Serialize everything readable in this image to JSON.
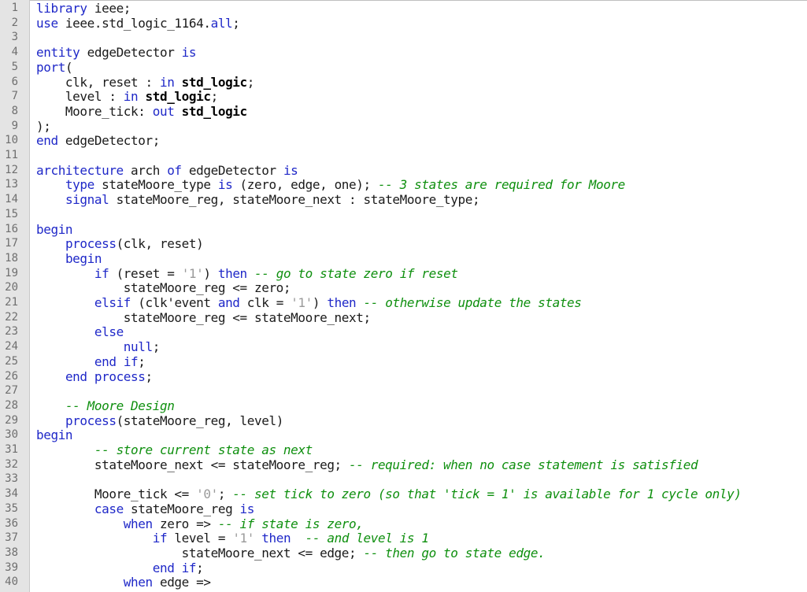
{
  "colors": {
    "keyword": "#1f28c8",
    "comment": "#0e8f0e",
    "string": "#9a9a9a",
    "plain": "#1a1a1a",
    "type_bold": "#000000",
    "gutter_background": "#e4e4e4",
    "line_number": "#6f6f6f"
  },
  "lines": [
    {
      "n": "1",
      "tokens": [
        {
          "t": "library",
          "k": "kw"
        },
        {
          "t": " ieee;",
          "k": "plain"
        }
      ]
    },
    {
      "n": "2",
      "tokens": [
        {
          "t": "use",
          "k": "kw"
        },
        {
          "t": " ieee.std_logic_1164.",
          "k": "plain"
        },
        {
          "t": "all",
          "k": "kw"
        },
        {
          "t": ";",
          "k": "plain"
        }
      ]
    },
    {
      "n": "3",
      "tokens": []
    },
    {
      "n": "4",
      "tokens": [
        {
          "t": "entity",
          "k": "kw"
        },
        {
          "t": " edgeDetector ",
          "k": "plain"
        },
        {
          "t": "is",
          "k": "kw"
        }
      ]
    },
    {
      "n": "5",
      "tokens": [
        {
          "t": "port",
          "k": "kw"
        },
        {
          "t": "(",
          "k": "plain"
        }
      ]
    },
    {
      "n": "6",
      "tokens": [
        {
          "t": "    clk, reset : ",
          "k": "plain"
        },
        {
          "t": "in",
          "k": "kw"
        },
        {
          "t": " ",
          "k": "plain"
        },
        {
          "t": "std_logic",
          "k": "type"
        },
        {
          "t": ";",
          "k": "plain"
        }
      ]
    },
    {
      "n": "7",
      "tokens": [
        {
          "t": "    level : ",
          "k": "plain"
        },
        {
          "t": "in",
          "k": "kw"
        },
        {
          "t": " ",
          "k": "plain"
        },
        {
          "t": "std_logic",
          "k": "type"
        },
        {
          "t": ";",
          "k": "plain"
        }
      ]
    },
    {
      "n": "8",
      "tokens": [
        {
          "t": "    Moore_tick: ",
          "k": "plain"
        },
        {
          "t": "out",
          "k": "kw"
        },
        {
          "t": " ",
          "k": "plain"
        },
        {
          "t": "std_logic",
          "k": "type"
        }
      ]
    },
    {
      "n": "9",
      "tokens": [
        {
          "t": ");",
          "k": "plain"
        }
      ]
    },
    {
      "n": "10",
      "tokens": [
        {
          "t": "end",
          "k": "kw"
        },
        {
          "t": " edgeDetector;",
          "k": "plain"
        }
      ]
    },
    {
      "n": "11",
      "tokens": []
    },
    {
      "n": "12",
      "tokens": [
        {
          "t": "architecture",
          "k": "kw"
        },
        {
          "t": " arch ",
          "k": "plain"
        },
        {
          "t": "of",
          "k": "kw"
        },
        {
          "t": " edgeDetector ",
          "k": "plain"
        },
        {
          "t": "is",
          "k": "kw"
        }
      ]
    },
    {
      "n": "13",
      "tokens": [
        {
          "t": "    ",
          "k": "plain"
        },
        {
          "t": "type",
          "k": "kw"
        },
        {
          "t": " stateMoore_type ",
          "k": "plain"
        },
        {
          "t": "is",
          "k": "kw"
        },
        {
          "t": " (zero, edge, one); ",
          "k": "plain"
        },
        {
          "t": "-- 3 states are required for Moore",
          "k": "comment"
        }
      ]
    },
    {
      "n": "14",
      "tokens": [
        {
          "t": "    ",
          "k": "plain"
        },
        {
          "t": "signal",
          "k": "kw"
        },
        {
          "t": " stateMoore_reg, stateMoore_next : stateMoore_type;",
          "k": "plain"
        }
      ]
    },
    {
      "n": "15",
      "tokens": []
    },
    {
      "n": "16",
      "tokens": [
        {
          "t": "begin",
          "k": "kw"
        }
      ]
    },
    {
      "n": "17",
      "tokens": [
        {
          "t": "    ",
          "k": "plain"
        },
        {
          "t": "process",
          "k": "kw"
        },
        {
          "t": "(clk, reset)",
          "k": "plain"
        }
      ]
    },
    {
      "n": "18",
      "tokens": [
        {
          "t": "    ",
          "k": "plain"
        },
        {
          "t": "begin",
          "k": "kw"
        }
      ]
    },
    {
      "n": "19",
      "tokens": [
        {
          "t": "        ",
          "k": "plain"
        },
        {
          "t": "if",
          "k": "kw"
        },
        {
          "t": " (reset = ",
          "k": "plain"
        },
        {
          "t": "'1'",
          "k": "str"
        },
        {
          "t": ") ",
          "k": "plain"
        },
        {
          "t": "then",
          "k": "kw"
        },
        {
          "t": " ",
          "k": "plain"
        },
        {
          "t": "-- go to state zero if reset",
          "k": "comment"
        }
      ]
    },
    {
      "n": "20",
      "tokens": [
        {
          "t": "            stateMoore_reg <= zero;",
          "k": "plain"
        }
      ]
    },
    {
      "n": "21",
      "tokens": [
        {
          "t": "        ",
          "k": "plain"
        },
        {
          "t": "elsif",
          "k": "kw"
        },
        {
          "t": " (clk'event ",
          "k": "plain"
        },
        {
          "t": "and",
          "k": "kw"
        },
        {
          "t": " clk = ",
          "k": "plain"
        },
        {
          "t": "'1'",
          "k": "str"
        },
        {
          "t": ") ",
          "k": "plain"
        },
        {
          "t": "then",
          "k": "kw"
        },
        {
          "t": " ",
          "k": "plain"
        },
        {
          "t": "-- otherwise update the states",
          "k": "comment"
        }
      ]
    },
    {
      "n": "22",
      "tokens": [
        {
          "t": "            stateMoore_reg <= stateMoore_next;",
          "k": "plain"
        }
      ]
    },
    {
      "n": "23",
      "tokens": [
        {
          "t": "        ",
          "k": "plain"
        },
        {
          "t": "else",
          "k": "kw"
        }
      ]
    },
    {
      "n": "24",
      "tokens": [
        {
          "t": "            ",
          "k": "plain"
        },
        {
          "t": "null",
          "k": "kw"
        },
        {
          "t": ";",
          "k": "plain"
        }
      ]
    },
    {
      "n": "25",
      "tokens": [
        {
          "t": "        ",
          "k": "plain"
        },
        {
          "t": "end",
          "k": "kw"
        },
        {
          "t": " ",
          "k": "plain"
        },
        {
          "t": "if",
          "k": "kw"
        },
        {
          "t": ";",
          "k": "plain"
        }
      ]
    },
    {
      "n": "26",
      "tokens": [
        {
          "t": "    ",
          "k": "plain"
        },
        {
          "t": "end",
          "k": "kw"
        },
        {
          "t": " ",
          "k": "plain"
        },
        {
          "t": "process",
          "k": "kw"
        },
        {
          "t": ";",
          "k": "plain"
        }
      ]
    },
    {
      "n": "27",
      "tokens": []
    },
    {
      "n": "28",
      "tokens": [
        {
          "t": "    ",
          "k": "plain"
        },
        {
          "t": "-- Moore Design",
          "k": "comment"
        }
      ]
    },
    {
      "n": "29",
      "tokens": [
        {
          "t": "    ",
          "k": "plain"
        },
        {
          "t": "process",
          "k": "kw"
        },
        {
          "t": "(stateMoore_reg, level)",
          "k": "plain"
        }
      ]
    },
    {
      "n": "30",
      "tokens": [
        {
          "t": "begin",
          "k": "kw"
        }
      ]
    },
    {
      "n": "31",
      "tokens": [
        {
          "t": "        ",
          "k": "plain"
        },
        {
          "t": "-- store current state as next",
          "k": "comment"
        }
      ]
    },
    {
      "n": "32",
      "tokens": [
        {
          "t": "        stateMoore_next <= stateMoore_reg; ",
          "k": "plain"
        },
        {
          "t": "-- required: when no case statement is satisfied",
          "k": "comment"
        }
      ]
    },
    {
      "n": "33",
      "tokens": []
    },
    {
      "n": "34",
      "tokens": [
        {
          "t": "        Moore_tick <= ",
          "k": "plain"
        },
        {
          "t": "'0'",
          "k": "str"
        },
        {
          "t": "; ",
          "k": "plain"
        },
        {
          "t": "-- set tick to zero (so that 'tick = 1' is available for 1 cycle only)",
          "k": "comment"
        }
      ]
    },
    {
      "n": "35",
      "tokens": [
        {
          "t": "        ",
          "k": "plain"
        },
        {
          "t": "case",
          "k": "kw"
        },
        {
          "t": " stateMoore_reg ",
          "k": "plain"
        },
        {
          "t": "is",
          "k": "kw"
        }
      ]
    },
    {
      "n": "36",
      "tokens": [
        {
          "t": "            ",
          "k": "plain"
        },
        {
          "t": "when",
          "k": "kw"
        },
        {
          "t": " zero => ",
          "k": "plain"
        },
        {
          "t": "-- if state is zero,",
          "k": "comment"
        }
      ]
    },
    {
      "n": "37",
      "tokens": [
        {
          "t": "                ",
          "k": "plain"
        },
        {
          "t": "if",
          "k": "kw"
        },
        {
          "t": " level = ",
          "k": "plain"
        },
        {
          "t": "'1'",
          "k": "str"
        },
        {
          "t": " ",
          "k": "plain"
        },
        {
          "t": "then",
          "k": "kw"
        },
        {
          "t": "  ",
          "k": "plain"
        },
        {
          "t": "-- and level is 1",
          "k": "comment"
        }
      ]
    },
    {
      "n": "38",
      "tokens": [
        {
          "t": "                    stateMoore_next <= edge; ",
          "k": "plain"
        },
        {
          "t": "-- then go to state edge.",
          "k": "comment"
        }
      ]
    },
    {
      "n": "39",
      "tokens": [
        {
          "t": "                ",
          "k": "plain"
        },
        {
          "t": "end",
          "k": "kw"
        },
        {
          "t": " ",
          "k": "plain"
        },
        {
          "t": "if",
          "k": "kw"
        },
        {
          "t": ";",
          "k": "plain"
        }
      ]
    },
    {
      "n": "40",
      "tokens": [
        {
          "t": "            ",
          "k": "plain"
        },
        {
          "t": "when",
          "k": "kw"
        },
        {
          "t": " edge =>",
          "k": "plain"
        }
      ]
    }
  ]
}
